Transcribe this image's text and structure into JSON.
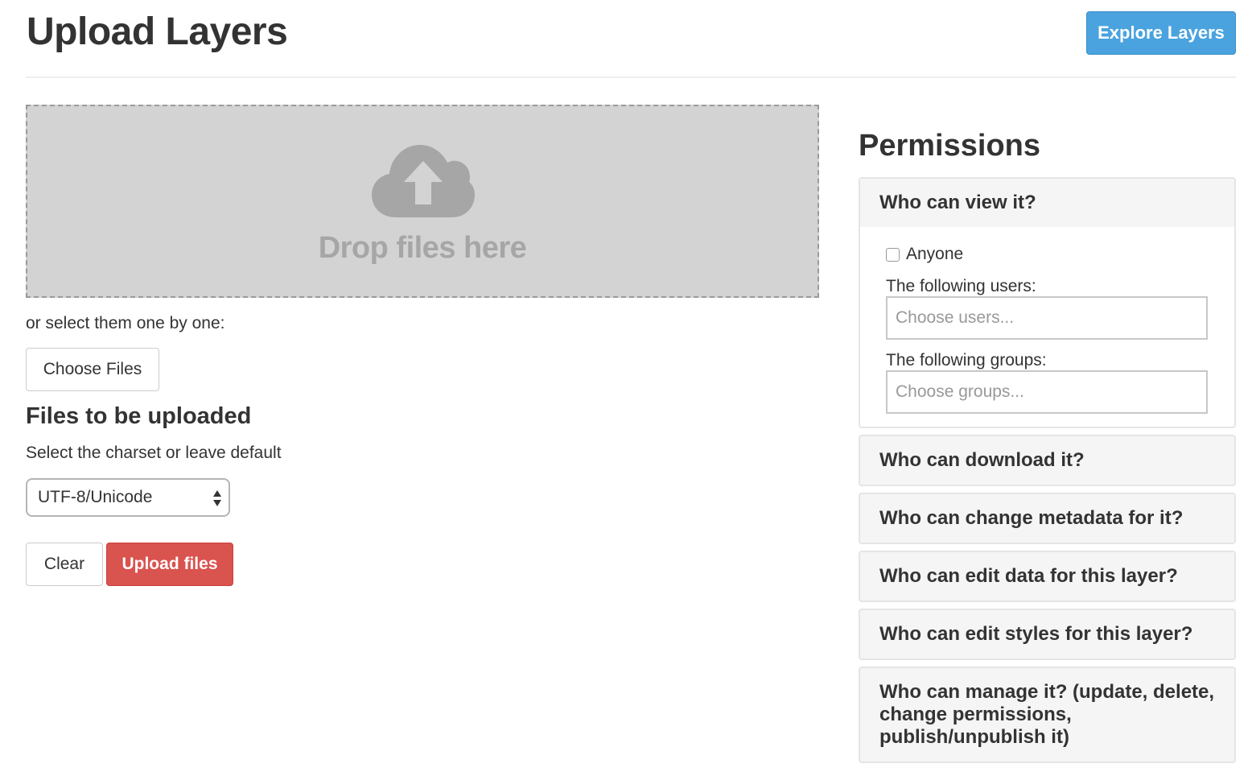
{
  "header": {
    "title": "Upload Layers",
    "explore_label": "Explore Layers"
  },
  "colors": {
    "primary": "#4aa3df",
    "danger": "#d9534f",
    "dropzone_bg": "#d3d3d3",
    "panel_bg": "#f5f5f5"
  },
  "upload": {
    "drop_icon": "cloud-upload-icon",
    "drop_text": "Drop files here",
    "select_label": "or select them one by one:",
    "choose_files_label": "Choose Files",
    "files_heading": "Files to be uploaded",
    "charset_label": "Select the charset or leave default",
    "charset_value": "UTF-8/Unicode",
    "clear_label": "Clear",
    "upload_label": "Upload files"
  },
  "permissions": {
    "title": "Permissions",
    "view": {
      "heading": "Who can view it?",
      "anyone_label": "Anyone",
      "anyone_checked": false,
      "users_label": "The following users:",
      "users_placeholder": "Choose users...",
      "groups_label": "The following groups:",
      "groups_placeholder": "Choose groups..."
    },
    "panels": [
      "Who can download it?",
      "Who can change metadata for it?",
      "Who can edit data for this layer?",
      "Who can edit styles for this layer?",
      "Who can manage it? (update, delete, change permissions, publish/unpublish it)"
    ]
  }
}
